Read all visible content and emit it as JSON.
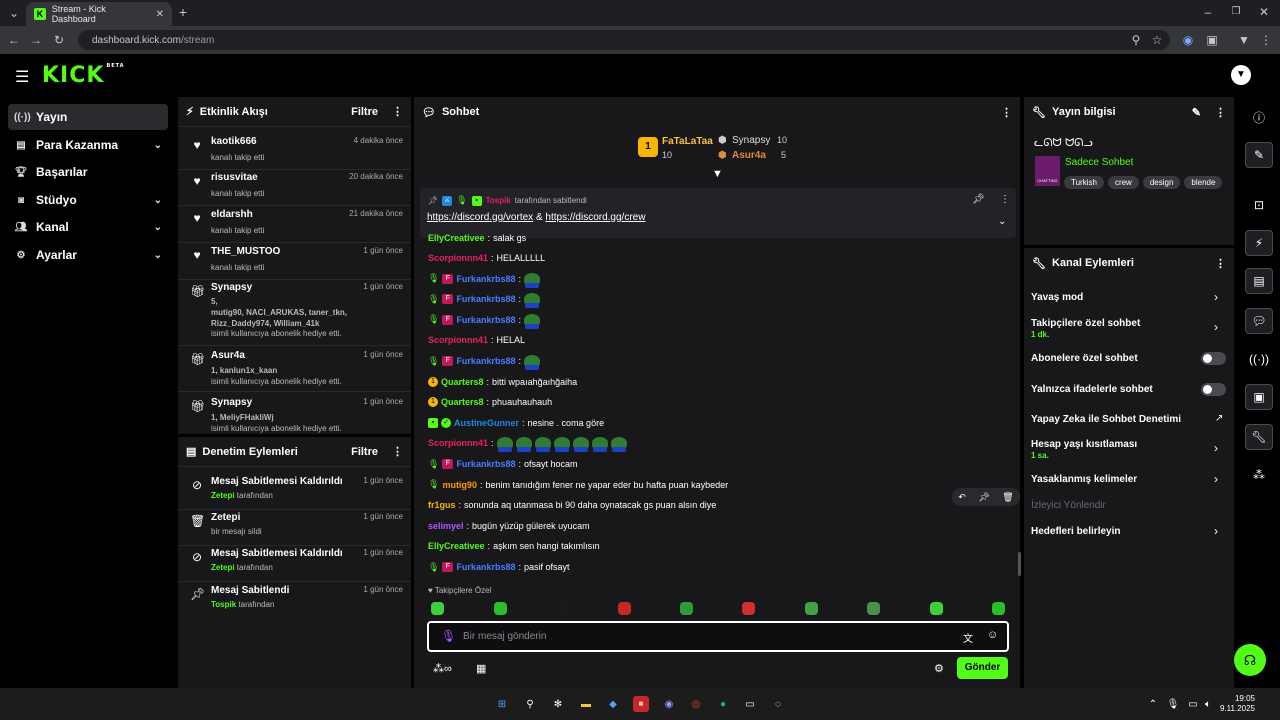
{
  "browser": {
    "tab_title": "Stream - Kick Dashboard",
    "favicon_letter": "K",
    "url_host": "dashboard.kick.com",
    "url_path": "/stream"
  },
  "app": {
    "logo_text": "KICK",
    "logo_badge": "BETA"
  },
  "sidebar": {
    "items": [
      {
        "label": "Yayın",
        "icon": "broadcast-icon"
      },
      {
        "label": "Para Kazanma",
        "icon": "dollar-icon"
      },
      {
        "label": "Başarılar",
        "icon": "trophy-icon"
      },
      {
        "label": "Stüdyo",
        "icon": "studio-icon"
      },
      {
        "label": "Kanal",
        "icon": "users-icon"
      },
      {
        "label": "Ayarlar",
        "icon": "gear-icon"
      }
    ]
  },
  "activity": {
    "title": "Etkinlik Akışı",
    "filter_label": "Filtre",
    "items": [
      {
        "name": "kaotik666",
        "time": "4 dakika önce",
        "text": "kanalı takip etti"
      },
      {
        "name": "risusvitae",
        "time": "20 dakika önce",
        "text": "kanalı takip etti"
      },
      {
        "name": "eldarshh",
        "time": "21 dakika önce",
        "text": "kanalı takip etti"
      },
      {
        "name": "THE_MUSTOO",
        "time": "1 gün önce",
        "text": "kanalı takip etti"
      },
      {
        "name": "Synapsy",
        "time": "1 gün önce",
        "count": "5,",
        "gifted": "mutig90, NACI_ARUKAS, taner_tkn, Rizz_Daddy974, William_41k",
        "text": "isimli kullanıcıya abonelik hediye etti."
      },
      {
        "name": "Asur4a",
        "time": "1 gün önce",
        "gifted": "1, kanlun1x_kaan",
        "text": "isimli kullanıcıya abonelik hediye etti."
      },
      {
        "name": "Synapsy",
        "time": "1 gün önce",
        "gifted": "1, MeliyFHakliWj",
        "text": "isimli kullanıcıya abonelik hediye etti."
      }
    ]
  },
  "moderation": {
    "title": "Denetim Eylemleri",
    "filter_label": "Filtre",
    "items": [
      {
        "title": "Mesaj Sabitlemesi Kaldırıldı",
        "time": "1 gün önce",
        "user": "Zetepi",
        "suffix": "tarafından"
      },
      {
        "title": "Zetepi",
        "time": "1 gün önce",
        "text": "bir mesajı sildi"
      },
      {
        "title": "Mesaj Sabitlemesi Kaldırıldı",
        "time": "1 gün önce",
        "user": "Zetepi",
        "suffix": "tarafından"
      },
      {
        "title": "Mesaj Sabitlendi",
        "time": "1 gün önce",
        "user": "Tospik",
        "suffix": "tarafından"
      }
    ]
  },
  "chat": {
    "title": "Sohbet",
    "leaderboard": {
      "first_name": "FaTaLaTaa",
      "first_count": "10",
      "second_name": "Synapsy",
      "second_count": "10",
      "third_name": "Asur4a",
      "third_count": "5"
    },
    "pinned": {
      "pinned_by": "Tospik",
      "pinned_suffix": "tarafından sabitlendi",
      "link1": "https://discord.gg/vortex",
      "amp": "&",
      "link2": "https://discord.gg/crew"
    },
    "partial_line": {
      "user": "EllyCreativee",
      "text": "salak gs"
    },
    "messages": [
      {
        "user": "Scorpionnn41",
        "color": "#e91e63",
        "text": "HELALLLLL",
        "badges": [],
        "emotes": 0
      },
      {
        "user": "Furkankrbs88",
        "color": "#4a7dff",
        "text": "",
        "badges": [
          "mic",
          "fur"
        ],
        "emotes": 1
      },
      {
        "user": "Furkankrbs88",
        "color": "#4a7dff",
        "text": "",
        "badges": [
          "mic",
          "fur"
        ],
        "emotes": 1
      },
      {
        "user": "Furkankrbs88",
        "color": "#4a7dff",
        "text": "",
        "badges": [
          "mic",
          "fur"
        ],
        "emotes": 1
      },
      {
        "user": "Scorpionnn41",
        "color": "#e91e63",
        "text": "HELAL",
        "badges": [],
        "emotes": 0
      },
      {
        "user": "Furkankrbs88",
        "color": "#4a7dff",
        "text": "",
        "badges": [
          "mic",
          "fur"
        ],
        "emotes": 1
      },
      {
        "user": "Quarters8",
        "color": "#53fc18",
        "text": "bitti wpaıahğaıhğaiha",
        "badges": [
          "one"
        ],
        "emotes": 0
      },
      {
        "user": "Quarters8",
        "color": "#53fc18",
        "text": "phuauhauhauh",
        "badges": [
          "one"
        ],
        "emotes": 0
      },
      {
        "user": "AustineGunner",
        "color": "#1e88e5",
        "text": "nesine . coma göre",
        "badges": [
          "gift",
          "verified"
        ],
        "emotes": 0
      },
      {
        "user": "Scorpionnn41",
        "color": "#e91e63",
        "text": "",
        "badges": [],
        "emotes": 7
      },
      {
        "user": "Furkankrbs88",
        "color": "#4a7dff",
        "text": "ofsayt hocam",
        "badges": [
          "mic",
          "fur"
        ],
        "emotes": 0
      },
      {
        "user": "mutig90",
        "color": "#ff9800",
        "text": "benim tanıdığım fener ne yapar eder bu hafta puan kaybeder",
        "badges": [
          "mic"
        ],
        "emotes": 0
      },
      {
        "user": "fr1gus",
        "color": "#f5b50a",
        "text": "sonunda aq utanmasa bi 90 daha oynatacak gs puan alsın diye",
        "badges": [],
        "emotes": 0
      },
      {
        "user": "selimyel",
        "color": "#b455ff",
        "text": "bugün yüzüp gülerek uyucam",
        "badges": [],
        "emotes": 0
      },
      {
        "user": "EllyCreativee",
        "color": "#53fc18",
        "text": "aşkım sen hangi takımlısın",
        "badges": [],
        "emotes": 0
      },
      {
        "user": "Furkankrbs88",
        "color": "#4a7dff",
        "text": "pasif ofsayt",
        "badges": [
          "mic",
          "fur"
        ],
        "emotes": 0
      }
    ],
    "followers_only_label": "Takipçilere Özel",
    "input_placeholder": "Bir mesaj gönderin",
    "send_label": "Gönder"
  },
  "stream_info": {
    "title": "Yayın bilgisi",
    "stream_title": "ᓚᘏᗢ ᗢᘏᓗ",
    "category": "Sadece Sohbet",
    "thumb_text": "CHATTING",
    "tags": [
      "Turkish",
      "crew",
      "design",
      "blende"
    ]
  },
  "channel_actions": {
    "title": "Kanal Eylemleri",
    "items": [
      {
        "label": "Yavaş mod",
        "type": "chevron"
      },
      {
        "label": "Takipçilere özel sohbet",
        "sub": "1 dk.",
        "type": "chevron"
      },
      {
        "label": "Abonelere özel sohbet",
        "type": "toggle"
      },
      {
        "label": "Yalnızca ifadelerle sohbet",
        "type": "toggle"
      },
      {
        "label": "Yapay Zeka ile Sohbet Denetimi",
        "type": "external"
      },
      {
        "label": "Hesap yaşı kısıtlaması",
        "sub": "1 sa.",
        "type": "chevron"
      },
      {
        "label": "Yasaklanmış kelimeler",
        "type": "chevron"
      },
      {
        "label": "İzleyici Yönlendir",
        "type": "disabled"
      },
      {
        "label": "Hedefleri belirleyin",
        "type": "chevron"
      }
    ]
  },
  "taskbar": {
    "time": "19:05",
    "date": "9.11.2025"
  },
  "colors": {
    "accent": "#53fc18",
    "panel": "#18181b",
    "background": "#000000"
  }
}
